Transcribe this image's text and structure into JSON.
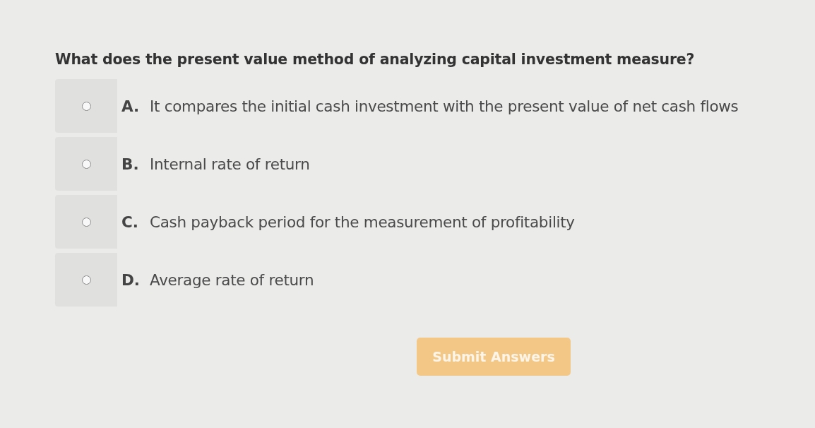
{
  "question": "What does the present value method of analyzing capital investment measure?",
  "options": [
    {
      "letter": "A.",
      "text": "It compares the initial cash investment with the present value of net cash flows",
      "selected": false
    },
    {
      "letter": "B.",
      "text": "Internal rate of return",
      "selected": false
    },
    {
      "letter": "C.",
      "text": "Cash payback period for the measurement of profitability",
      "selected": false
    },
    {
      "letter": "D.",
      "text": "Average rate of return",
      "selected": false
    }
  ],
  "submit_button": {
    "label": "Submit Answers",
    "disabled": true
  }
}
